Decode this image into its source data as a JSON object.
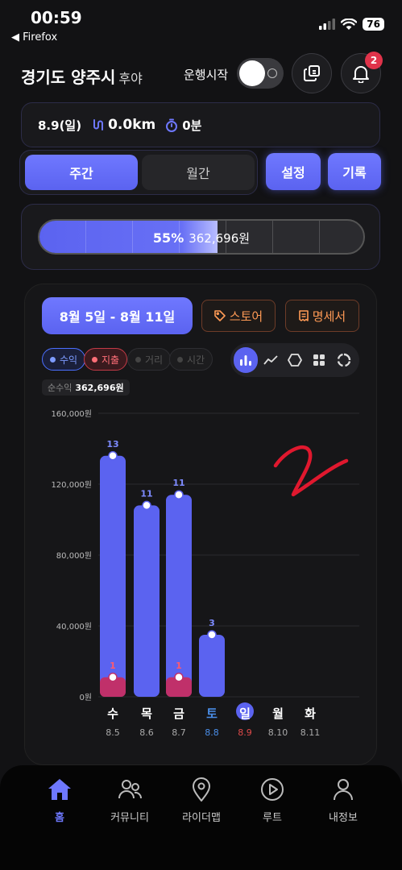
{
  "status": {
    "time": "00:59",
    "back_app": "◀ Firefox",
    "battery": "76"
  },
  "header": {
    "region": "경기도 양주시",
    "region_sub": "후야",
    "run_label": "운행시작",
    "notification_count": "2"
  },
  "summary": {
    "date": "8.9(일)",
    "distance": "0.0km",
    "time": "0분"
  },
  "tabs": {
    "weekly": "주간",
    "monthly": "월간"
  },
  "buttons": {
    "settings": "설정",
    "records": "기록"
  },
  "progress": {
    "percent_label": "55%",
    "amount": "362,696원",
    "fraction": 0.55
  },
  "chart_panel": {
    "week_range": "8월 5일 - 8월 11일",
    "store_label": "스토어",
    "statement_label": "명세서",
    "chips": {
      "income": "수익",
      "expense": "지출",
      "distance": "거리",
      "time": "시간"
    },
    "net_label": "순수익",
    "net_value": "362,696원"
  },
  "chart_data": {
    "type": "bar",
    "categories": [
      "수",
      "목",
      "금",
      "토",
      "일",
      "월",
      "화"
    ],
    "dates": [
      "8.5",
      "8.6",
      "8.7",
      "8.8",
      "8.9",
      "8.10",
      "8.11"
    ],
    "y_ticks": [
      "160,000원",
      "120,000원",
      "80,000원",
      "40,000원",
      "0원"
    ],
    "ylim": [
      0,
      160000
    ],
    "series": [
      {
        "name": "수익",
        "color": "#5b63f0",
        "values": [
          136000,
          108000,
          114000,
          35000,
          null,
          null,
          null
        ],
        "labels": [
          "13",
          "11",
          "11",
          "3",
          "",
          "",
          ""
        ]
      },
      {
        "name": "지출",
        "color": "#c0306a",
        "values": [
          11000,
          null,
          11000,
          null,
          null,
          null,
          null
        ],
        "labels": [
          "1",
          "",
          "1",
          "",
          "",
          "",
          ""
        ]
      }
    ],
    "highlight": {
      "today_index": 4,
      "saturday_color": "#4a8ee8",
      "sunday_color": "#e04a4a"
    },
    "grid": true
  },
  "nav": {
    "items": [
      {
        "label": "홈",
        "icon": "home-icon"
      },
      {
        "label": "커뮤니티",
        "icon": "users-icon"
      },
      {
        "label": "라이더맵",
        "icon": "map-pin-icon"
      },
      {
        "label": "루트",
        "icon": "play-circle-icon"
      },
      {
        "label": "내정보",
        "icon": "user-icon"
      }
    ]
  },
  "colors": {
    "accent": "#5b63f0",
    "background": "#121214"
  }
}
